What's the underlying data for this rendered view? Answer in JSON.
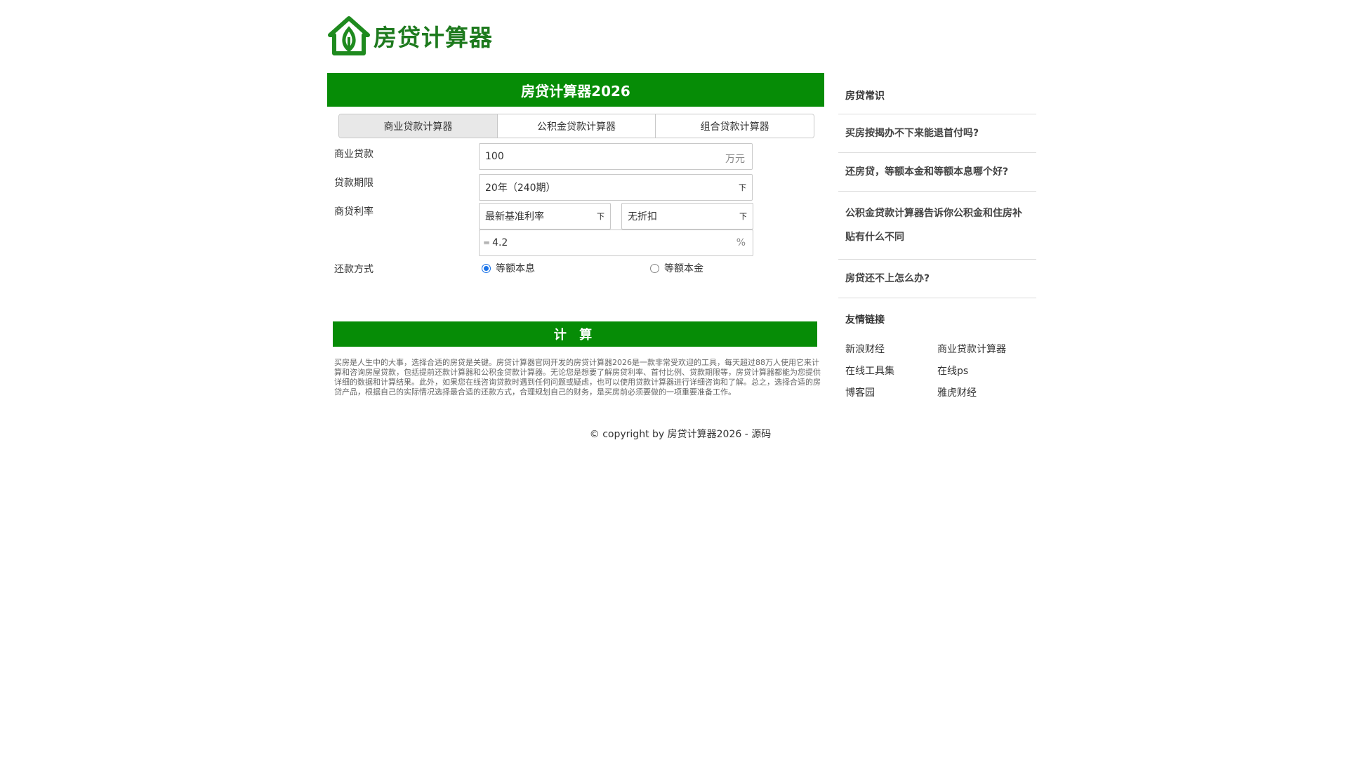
{
  "logo": {
    "text": "房贷计算器",
    "icon": "house-leaf-icon",
    "color": "#1e7a1e"
  },
  "main": {
    "title": "房贷计算器2026",
    "accent": "#068c06",
    "tabs": [
      {
        "label": "商业贷款计算器",
        "active": true
      },
      {
        "label": "公积金贷款计算器",
        "active": false
      },
      {
        "label": "组合贷款计算器",
        "active": false
      }
    ],
    "loan": {
      "label": "商业贷款",
      "value": "100",
      "unit": "万元"
    },
    "term": {
      "label": "贷款期限",
      "value": "20年（240期）",
      "arrow": "下"
    },
    "rate": {
      "label": "商贷利率",
      "base_select": "最新基准利率",
      "discount_select": "无折扣",
      "arrow": "下",
      "prefix": "=",
      "value": "4.2",
      "unit": "%"
    },
    "repay": {
      "label": "还款方式",
      "option1": "等额本息",
      "option2": "等额本金",
      "selected": "等额本息"
    },
    "calc_button": "计 算",
    "description": "买房是人生中的大事，选择合适的房贷是关键。房贷计算器官网开发的房贷计算器2026是一款非常受欢迎的工具，每天超过88万人使用它来计算和咨询房屋贷款，包括提前还款计算器和公积金贷款计算器。无论您是想要了解房贷利率、首付比例、贷款期限等，房贷计算器都能为您提供详细的数据和计算结果。此外，如果您在线咨询贷款时遇到任何问题或疑虑，也可以使用贷款计算器进行详细咨询和了解。总之，选择合适的房贷产品，根据自己的实际情况选择最合适的还款方式，合理规划自己的财务，是买房前必须要做的一项重要准备工作。"
  },
  "sidebar": {
    "title": "房贷常识",
    "items": [
      "买房按揭办不下来能退首付吗?",
      "还房贷，等额本金和等额本息哪个好?",
      "公积金贷款计算器告诉你公积金和住房补贴有什么不同",
      "房贷还不上怎么办?"
    ],
    "friend_title": "友情链接",
    "links": [
      "新浪财经",
      "商业贷款计算器",
      "在线工具集",
      "在线ps",
      "博客园",
      "雅虎财经"
    ]
  },
  "footer": "© copyright by 房贷计算器2026 - 源码"
}
